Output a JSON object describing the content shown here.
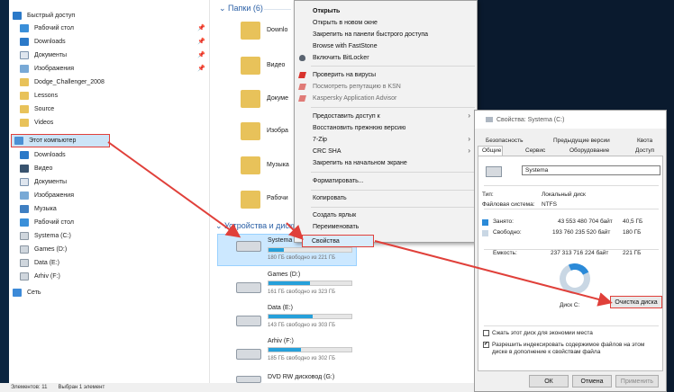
{
  "nav": {
    "quick_access": "Быстрый доступ",
    "quick_items": [
      {
        "label": "Рабочий стол",
        "pin": "📌"
      },
      {
        "label": "Downloads",
        "pin": "📌"
      },
      {
        "label": "Документы",
        "pin": "📌"
      },
      {
        "label": "Изображения",
        "pin": "📌"
      },
      {
        "label": "Dodge_Challenger_2008",
        "pin": ""
      },
      {
        "label": "Lessons",
        "pin": ""
      },
      {
        "label": "Source",
        "pin": ""
      },
      {
        "label": "Videos",
        "pin": ""
      }
    ],
    "this_pc": "Этот компьютер",
    "pc_items": [
      "Downloads",
      "Видео",
      "Документы",
      "Изображения",
      "Музыка",
      "Рабочий стол",
      "Systema (C:)",
      "Games (D:)",
      "Data (E:)",
      "Arhiv (F:)"
    ],
    "network": "Сеть"
  },
  "main": {
    "folders_group": "Папки (6)",
    "folders": [
      "Downlo",
      "Видео",
      "Докуме",
      "Изобра",
      "Музыка",
      "Рабочи"
    ],
    "drives_group": "Устройства и диски",
    "drives": [
      {
        "name": "Systema",
        "free": "180 ГБ свободно из 221 ГБ",
        "fill": 0.19
      },
      {
        "name": "Games (D:)",
        "free": "161 ГБ свободно из 323 ГБ",
        "fill": 0.5
      },
      {
        "name": "Data (E:)",
        "free": "143 ГБ свободно из 303 ГБ",
        "fill": 0.53
      },
      {
        "name": "Arhiv (F:)",
        "free": "185 ГБ свободно из 302 ГБ",
        "fill": 0.39
      },
      {
        "name": "DVD RW дисковод (G:)",
        "free": "",
        "fill": 0
      }
    ]
  },
  "status": {
    "count": "Элементов: 11",
    "selected": "Выбран 1 элемент"
  },
  "context_menu": {
    "items": [
      {
        "label": "Открыть",
        "bold": true
      },
      {
        "label": "Открыть в новом окне"
      },
      {
        "label": "Закрепить на панели быстрого доступа"
      },
      {
        "label": "Browse with FastStone"
      },
      {
        "label": "Включить BitLocker",
        "icon": "shield-icon"
      },
      {
        "label": "Проверить на вирусы",
        "icon": "kaspersky-icon"
      },
      {
        "label": "Посмотреть репутацию в KSN",
        "icon": "kaspersky-icon",
        "gray": true
      },
      {
        "label": "Kaspersky Application Advisor",
        "icon": "kaspersky-icon",
        "gray": true
      },
      {
        "label": "Предоставить доступ к",
        "arrow": "›"
      },
      {
        "label": "Восстановить прежнюю версию"
      },
      {
        "label": "7-Zip",
        "arrow": "›"
      },
      {
        "label": "CRC SHA",
        "arrow": "›"
      },
      {
        "label": "Закрепить на начальном экране"
      },
      {
        "label": "Форматировать..."
      },
      {
        "label": "Копировать"
      },
      {
        "label": "Создать ярлык"
      },
      {
        "label": "Переименовать"
      },
      {
        "label": "Свойства"
      }
    ]
  },
  "dialog": {
    "title": "Свойства: Systema (C:)",
    "tabs_row1": [
      "Безопасность",
      "Предыдущие версии",
      "Квота"
    ],
    "tabs_row2": [
      "Общие",
      "Сервис",
      "Оборудование",
      "Доступ"
    ],
    "name_value": "Systema",
    "type_label": "Тип:",
    "type_value": "Локальный диск",
    "fs_label": "Файловая система:",
    "fs_value": "NTFS",
    "used_label": "Занято:",
    "used_bytes": "43 553 480 704 байт",
    "used_gb": "40,5 ГБ",
    "free_label": "Свободно:",
    "free_bytes": "193 760 235 520 байт",
    "free_gb": "180 ГБ",
    "cap_label": "Емкость:",
    "cap_bytes": "237 313 716 224 байт",
    "cap_gb": "221 ГБ",
    "used_fraction": 0.18,
    "disk_label": "Диск C:",
    "cleanup_button": "Очистка диска",
    "compress_label": "Сжать этот диск для экономии места",
    "index_label": "Разрешить индексировать содержимое файлов на этом диске в дополнение к свойствам файла",
    "ok": "ОК",
    "cancel": "Отмена",
    "apply": "Применить"
  },
  "colors": {
    "accent": "#e0403a",
    "used": "#2b8ad8",
    "free": "#c9d7e4",
    "bar": "#26a0da"
  }
}
